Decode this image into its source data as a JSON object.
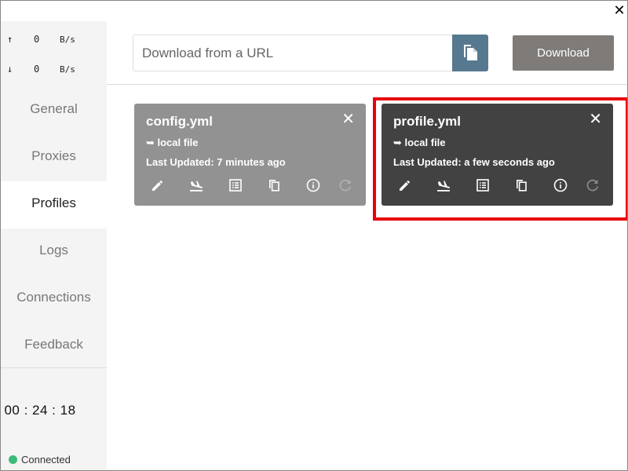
{
  "window": {
    "close_glyph": "✕"
  },
  "traffic": {
    "up": {
      "arrow": "↑",
      "value": "0",
      "unit": "B/s"
    },
    "down": {
      "arrow": "↓",
      "value": "0",
      "unit": "B/s"
    }
  },
  "sidebar": {
    "items": [
      {
        "label": "General"
      },
      {
        "label": "Proxies"
      },
      {
        "label": "Profiles",
        "active": true
      },
      {
        "label": "Logs"
      },
      {
        "label": "Connections"
      },
      {
        "label": "Feedback"
      }
    ],
    "timer": "00 : 24 : 18",
    "status": {
      "label": "Connected",
      "color": "#3cbb7a"
    }
  },
  "topbar": {
    "url_placeholder": "Download from a URL",
    "url_value": "",
    "paste_icon": "paste-icon",
    "download_label": "Download"
  },
  "profiles": [
    {
      "name": "config.yml",
      "source": "➥ local file",
      "updated": "Last Updated: 7 minutes ago",
      "selected": false
    },
    {
      "name": "profile.yml",
      "source": "➥ local file",
      "updated": "Last Updated: a few seconds ago",
      "selected": true
    }
  ],
  "card_actions": [
    "edit-icon",
    "flight-land-icon",
    "list-icon",
    "copy-icon",
    "info-icon",
    "refresh-icon"
  ],
  "colors": {
    "card_selected": "#424242",
    "card_unselected": "#929292",
    "accent_button": "#57798f",
    "download_button": "#7e7b78",
    "highlight": "#e8000b"
  }
}
